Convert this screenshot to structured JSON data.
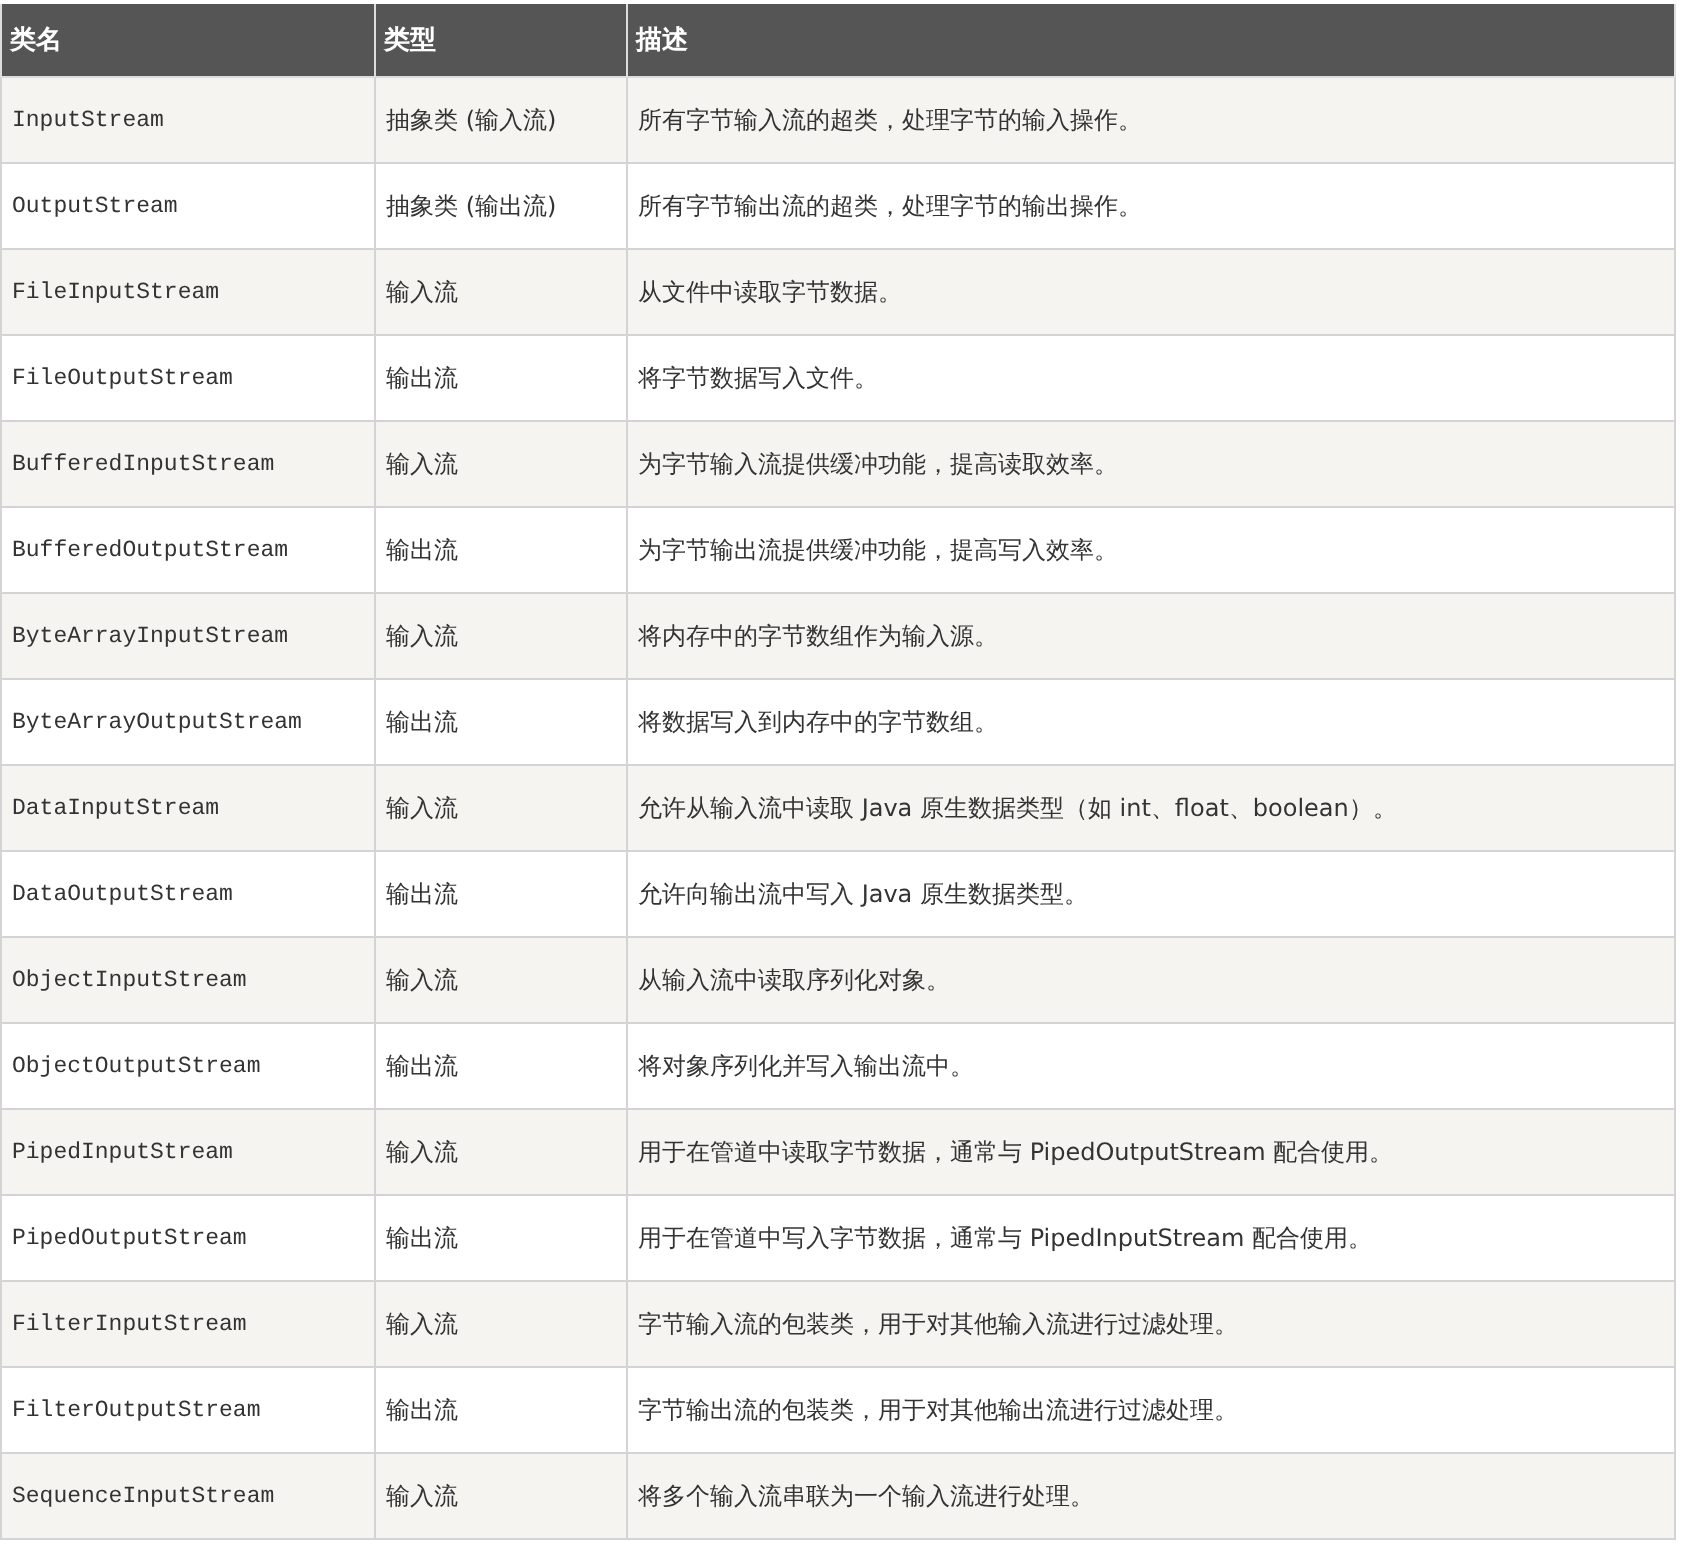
{
  "table": {
    "columns": [
      "类名",
      "类型",
      "描述"
    ],
    "rows": [
      [
        "InputStream",
        "抽象类 (输入流)",
        "所有字节输入流的超类，处理字节的输入操作。"
      ],
      [
        "OutputStream",
        "抽象类 (输出流)",
        "所有字节输出流的超类，处理字节的输出操作。"
      ],
      [
        "FileInputStream",
        "输入流",
        "从文件中读取字节数据。"
      ],
      [
        "FileOutputStream",
        "输出流",
        "将字节数据写入文件。"
      ],
      [
        "BufferedInputStream",
        "输入流",
        "为字节输入流提供缓冲功能，提高读取效率。"
      ],
      [
        "BufferedOutputStream",
        "输出流",
        "为字节输出流提供缓冲功能，提高写入效率。"
      ],
      [
        "ByteArrayInputStream",
        "输入流",
        "将内存中的字节数组作为输入源。"
      ],
      [
        "ByteArrayOutputStream",
        "输出流",
        "将数据写入到内存中的字节数组。"
      ],
      [
        "DataInputStream",
        "输入流",
        "允许从输入流中读取 Java 原生数据类型（如 int、float、boolean）。"
      ],
      [
        "DataOutputStream",
        "输出流",
        "允许向输出流中写入 Java 原生数据类型。"
      ],
      [
        "ObjectInputStream",
        "输入流",
        "从输入流中读取序列化对象。"
      ],
      [
        "ObjectOutputStream",
        "输出流",
        "将对象序列化并写入输出流中。"
      ],
      [
        "PipedInputStream",
        "输入流",
        "用于在管道中读取字节数据，通常与 PipedOutputStream 配合使用。"
      ],
      [
        "PipedOutputStream",
        "输出流",
        "用于在管道中写入字节数据，通常与 PipedInputStream 配合使用。"
      ],
      [
        "FilterInputStream",
        "输入流",
        "字节输入流的包装类，用于对其他输入流进行过滤处理。"
      ],
      [
        "FilterOutputStream",
        "输出流",
        "字节输出流的包装类，用于对其他输出流进行过滤处理。"
      ],
      [
        "SequenceInputStream",
        "输入流",
        "将多个输入流串联为一个输入流进行处理。"
      ]
    ]
  }
}
